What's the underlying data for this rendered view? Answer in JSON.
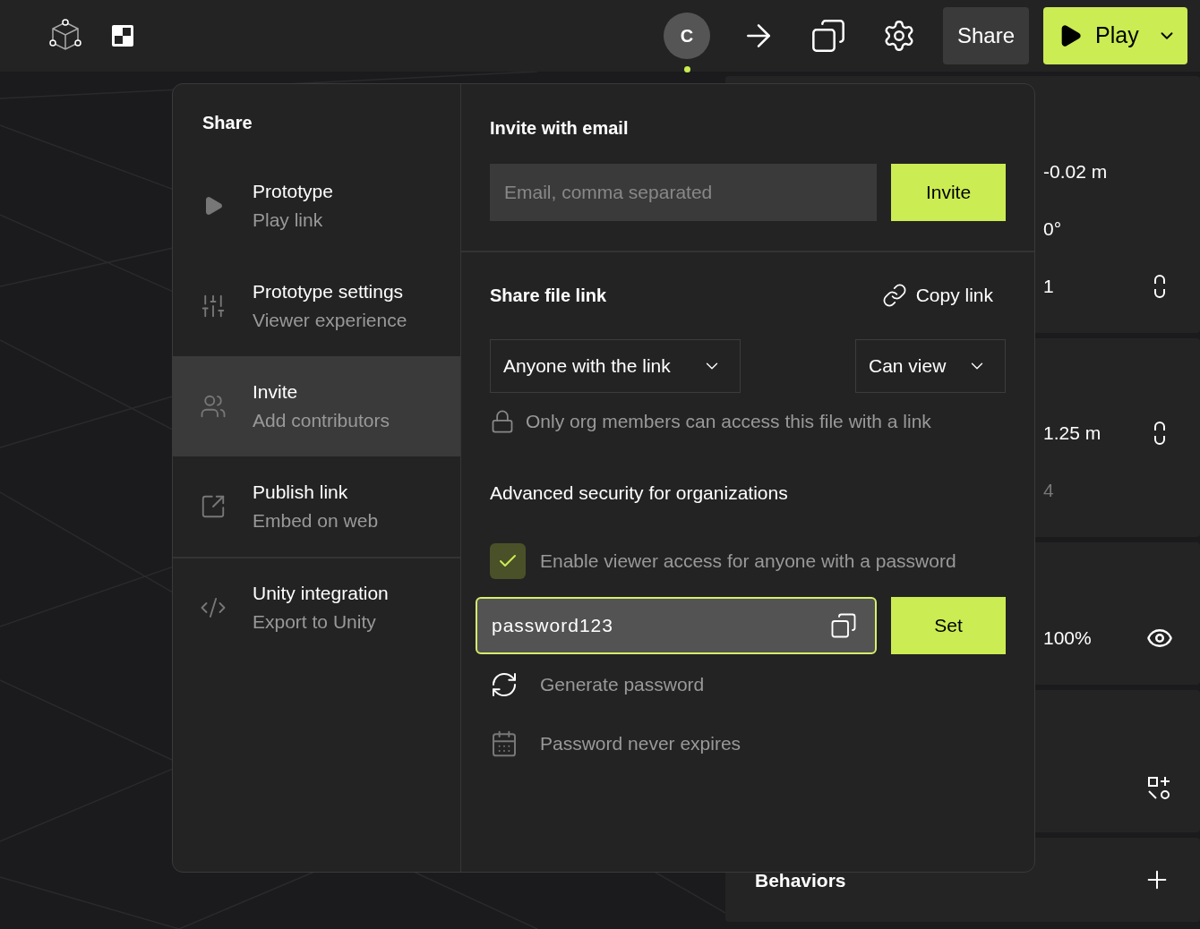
{
  "toolbar": {
    "avatar": {
      "initial": "C",
      "online": true
    },
    "share_button": "Share",
    "play_button": "Play"
  },
  "properties_panel": {
    "cards": [
      {
        "rows": [
          {
            "value": "-0.02 m",
            "kind": "plain",
            "muted": false
          },
          {
            "value": "0°",
            "kind": "plain",
            "muted": false
          },
          {
            "value": "1",
            "kind": "linked",
            "muted": false
          }
        ]
      },
      {
        "rows": [
          {
            "value": "1.25 m",
            "kind": "linked",
            "muted": false
          },
          {
            "value": "4",
            "kind": "plain",
            "muted": true
          }
        ]
      },
      {
        "rows": [
          {
            "value": "100%",
            "kind": "visibility"
          }
        ]
      },
      {
        "rows": [
          {
            "kind": "add_shape"
          }
        ]
      }
    ],
    "behaviors": {
      "title": "Behaviors"
    }
  },
  "share_dialog": {
    "title": "Share",
    "nav_items": [
      {
        "title": "Prototype",
        "subtitle": "Play link",
        "kind": "prototype",
        "selected": false,
        "divider_before": false
      },
      {
        "title": "Prototype settings",
        "subtitle": "Viewer experience",
        "kind": "settings",
        "selected": false,
        "divider_before": false
      },
      {
        "title": "Invite",
        "subtitle": "Add contributors",
        "kind": "invite",
        "selected": true,
        "divider_before": false
      },
      {
        "title": "Publish link",
        "subtitle": "Embed on web",
        "kind": "publish",
        "selected": false,
        "divider_before": false
      },
      {
        "title": "Unity integration",
        "subtitle": "Export to Unity",
        "kind": "integration",
        "selected": false,
        "divider_before": true
      }
    ],
    "invite": {
      "title": "Invite with email",
      "placeholder": "Email, comma separated",
      "button": "Invite"
    },
    "file_link": {
      "title": "Share file link",
      "copy_link": "Copy link",
      "access": "Anyone with the link",
      "permission": "Can view",
      "note": "Only org members can access this file with a link",
      "advanced_title": "Advanced security for organizations",
      "password_access": {
        "label": "Enable viewer access for anyone with a password",
        "checked": true
      },
      "password": "password123",
      "set_button": "Set",
      "generate": "Generate password",
      "expires": "Password never expires"
    }
  }
}
